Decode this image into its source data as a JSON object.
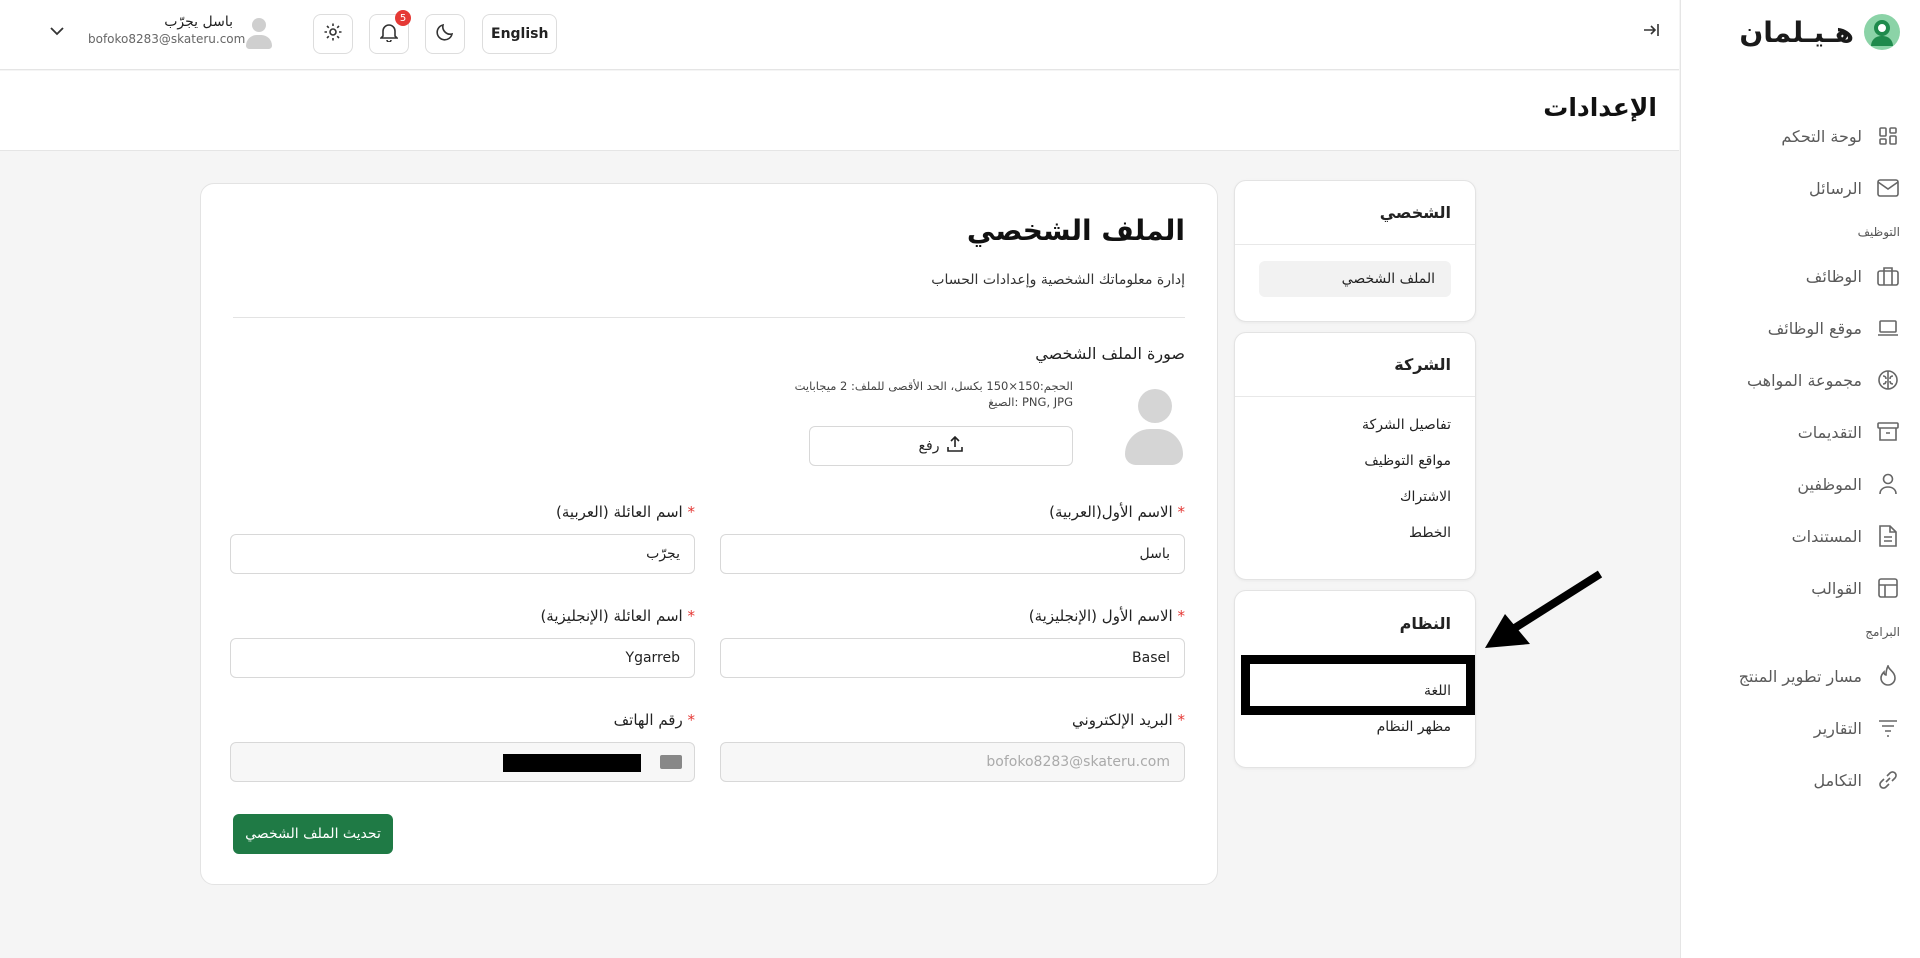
{
  "brand": {
    "name": "هـيـلمان",
    "accent": "#1f7a45"
  },
  "sidebar": {
    "items": [
      {
        "label": "لوحة التحكم",
        "icon": "dashboard-icon"
      },
      {
        "label": "الرسائل",
        "icon": "mail-icon"
      }
    ],
    "section_recruitment": "التوظيف",
    "recruitment_items": [
      {
        "label": "الوظائف",
        "icon": "briefcase-icon"
      },
      {
        "label": "موقع الوظائف",
        "icon": "laptop-icon"
      },
      {
        "label": "مجموعة المواهب",
        "icon": "brain-icon"
      },
      {
        "label": "التقديمات",
        "icon": "inbox-icon"
      },
      {
        "label": "الموظفين",
        "icon": "user-icon"
      },
      {
        "label": "المستندات",
        "icon": "file-icon"
      },
      {
        "label": "القوالب",
        "icon": "template-icon"
      }
    ],
    "section_programs": "البرامج",
    "program_items": [
      {
        "label": "مسار تطوير المنتج",
        "icon": "flame-icon"
      },
      {
        "label": "التقارير",
        "icon": "filter-icon"
      },
      {
        "label": "التكامل",
        "icon": "link-icon"
      }
    ]
  },
  "topbar": {
    "user_name": "باسل يجرّب",
    "user_email": "bofoko8283@skateru.com",
    "notifications_count": "5",
    "language_label": "English"
  },
  "page": {
    "title": "الإعدادات"
  },
  "settings_nav": {
    "personal_title": "الشخصي",
    "personal_items": [
      "الملف الشخصي"
    ],
    "company_title": "الشركة",
    "company_items": [
      "تفاصيل الشركة",
      "مواقع التوظيف",
      "الاشتراك",
      "الخطط"
    ],
    "system_title": "النظام",
    "system_items": [
      "اللغة",
      "مظهر النظام"
    ]
  },
  "profile": {
    "title": "الملف الشخصي",
    "subtitle": "إدارة معلوماتك الشخصية وإعدادات الحساب",
    "photo_label": "صورة الملف الشخصي",
    "photo_hint_size": "الحجم:150×150 بكسل، الحد الأقصى للملف: 2 ميجابايت",
    "photo_hint_format": "الصيغ: PNG, JPG",
    "upload_label": "رفع",
    "first_name_ar_label": "الاسم الأول(العربية)",
    "first_name_ar_value": "باسل",
    "last_name_ar_label": "اسم العائلة (العربية)",
    "last_name_ar_value": "يجرّب",
    "first_name_en_label": "الاسم الأول (الإنجليزية)",
    "first_name_en_value": "Basel",
    "last_name_en_label": "اسم العائلة (الإنجليزية)",
    "last_name_en_value": "Ygarreb",
    "email_label": "البريد الإلكتروني",
    "email_value": "bofoko8283@skateru.com",
    "phone_label": "رقم الهاتف",
    "submit_label": "تحديث الملف الشخصي"
  }
}
